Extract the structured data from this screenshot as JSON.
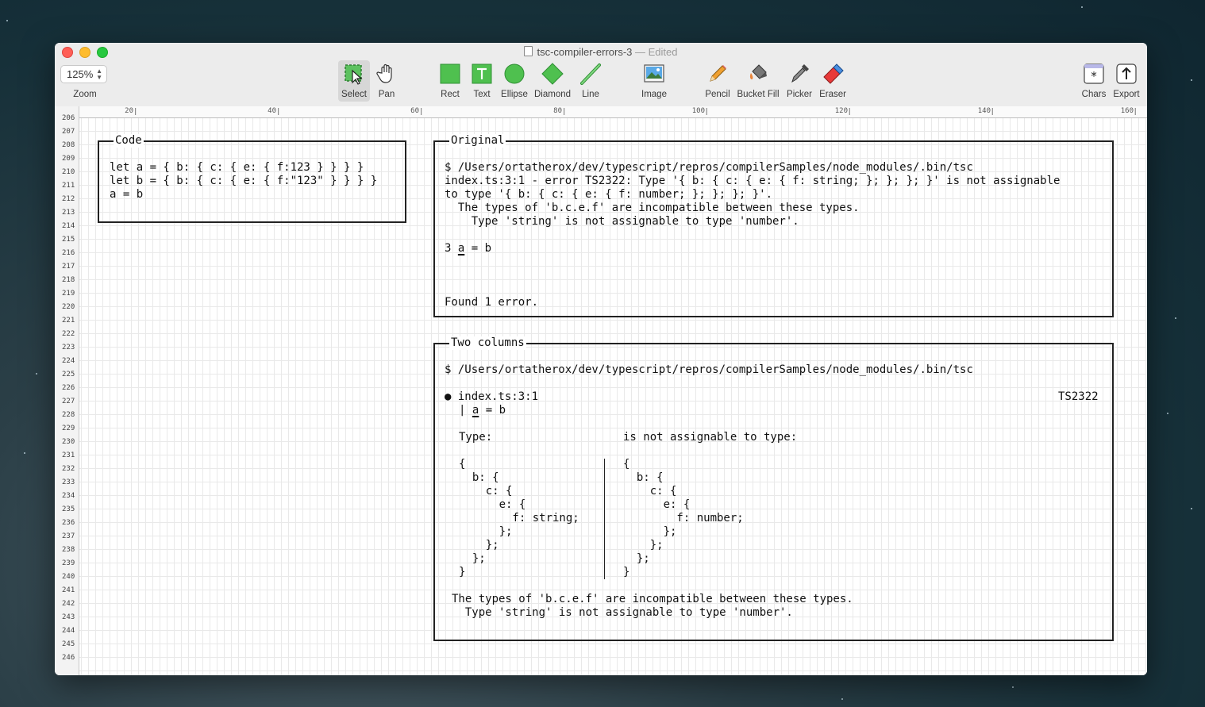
{
  "window": {
    "title": "tsc-compiler-errors-3",
    "status": "— Edited"
  },
  "toolbar": {
    "zoom_value": "125%",
    "zoom_label": "Zoom",
    "tools": [
      {
        "label": "Select",
        "icon": "select-icon"
      },
      {
        "label": "Pan",
        "icon": "hand-icon"
      },
      {
        "label": "Rect",
        "icon": "rect-icon"
      },
      {
        "label": "Text",
        "icon": "text-icon"
      },
      {
        "label": "Ellipse",
        "icon": "ellipse-icon"
      },
      {
        "label": "Diamond",
        "icon": "diamond-icon"
      },
      {
        "label": "Line",
        "icon": "line-icon"
      },
      {
        "label": "Image",
        "icon": "image-icon"
      },
      {
        "label": "Pencil",
        "icon": "pencil-icon"
      },
      {
        "label": "Bucket Fill",
        "icon": "bucket-icon"
      },
      {
        "label": "Picker",
        "icon": "picker-icon"
      },
      {
        "label": "Eraser",
        "icon": "eraser-icon"
      },
      {
        "label": "Chars",
        "icon": "chars-icon"
      },
      {
        "label": "Export",
        "icon": "export-icon"
      }
    ],
    "accent_color": "#3fb950"
  },
  "ruler": [
    "20",
    "40",
    "60",
    "80",
    "100",
    "120",
    "140",
    "160"
  ],
  "line_numbers": [
    "206",
    "207",
    "208",
    "209",
    "210",
    "211",
    "212",
    "213",
    "214",
    "215",
    "216",
    "217",
    "218",
    "219",
    "220",
    "221",
    "222",
    "223",
    "224",
    "225",
    "226",
    "227",
    "228",
    "229",
    "230",
    "231",
    "232",
    "233",
    "234",
    "235",
    "236",
    "237",
    "238",
    "239",
    "240",
    "241",
    "242",
    "243",
    "244",
    "245",
    "246"
  ],
  "boxes": {
    "code": {
      "title": "Code",
      "lines": [
        "let a = { b: { c: { e: { f:123 } } } }",
        "let b = { b: { c: { e: { f:\"123\" } } } }",
        "a = b"
      ]
    },
    "original": {
      "title": "Original",
      "cmd": "$ /Users/ortatherox/dev/typescript/repros/compilerSamples/node_modules/.bin/tsc",
      "error1": "index.ts:3:1 - error TS2322: Type '{ b: { c: { e: { f: string; }; }; }; }' is not assignable",
      "error2": "to type '{ b: { c: { e: { f: number; }; }; }; }'.",
      "error3": "  The types of 'b.c.e.f' are incompatible between these types.",
      "error4": "    Type 'string' is not assignable to type 'number'.",
      "src_line_no": "3 ",
      "src_var": "a",
      "src_rest": " = b",
      "found": "Found 1 error."
    },
    "two_columns": {
      "title": "Two columns",
      "cmd": "$ /Users/ortatherox/dev/typescript/repros/compilerSamples/node_modules/.bin/tsc",
      "bullet_file": "● index.ts:3:1",
      "code": "TS2322",
      "src_pipe": "| ",
      "src_var": "a",
      "src_rest": " = b",
      "type_label": "Type:",
      "assign_label": "is not assignable to type:",
      "left_type": "{\n  b: {\n    c: {\n      e: {\n        f: string;\n      };\n    };\n  };\n}",
      "right_type": "{\n  b: {\n    c: {\n      e: {\n        f: number;\n      };\n    };\n  };\n}",
      "footer1": "The types of 'b.c.e.f' are incompatible between these types.",
      "footer2": "  Type 'string' is not assignable to type 'number'."
    }
  }
}
